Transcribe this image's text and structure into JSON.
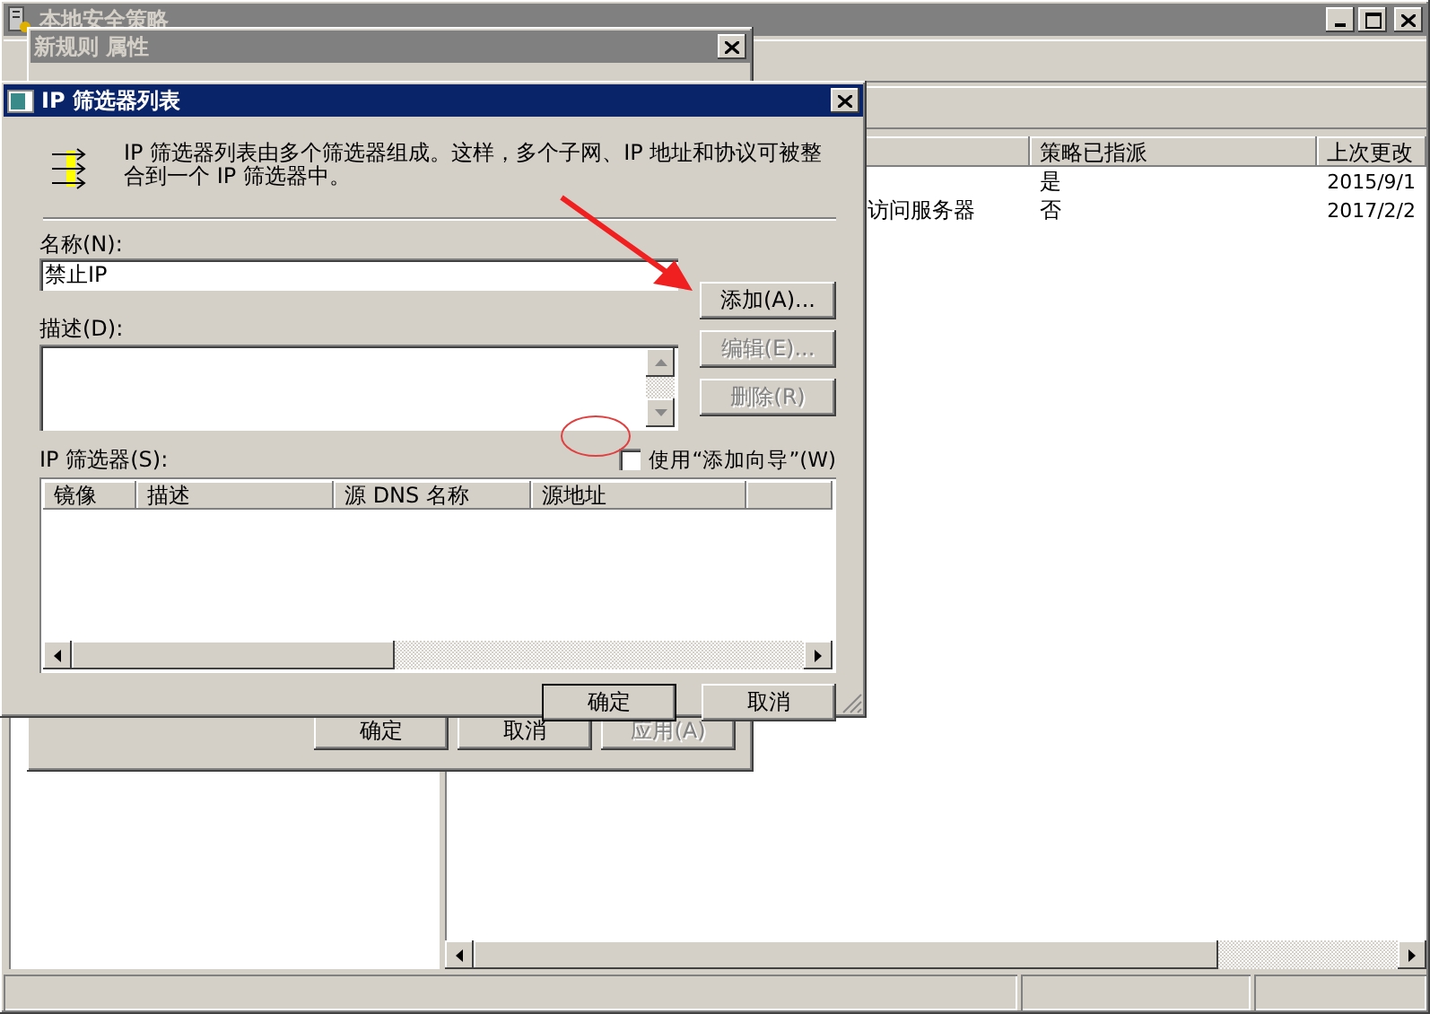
{
  "main_window": {
    "title": "本地安全策略",
    "list": {
      "columns": [
        {
          "label": "策略已指派"
        },
        {
          "label": "上次更改"
        }
      ],
      "rows": [
        {
          "assigned": "是",
          "changed": "2015/9/1"
        },
        {
          "name": "访问服务器",
          "assigned": "否",
          "changed": "2017/2/2"
        }
      ]
    }
  },
  "properties_dialog": {
    "title": "新规则 属性",
    "buttons": [
      {
        "label": "确定",
        "disabled": false
      },
      {
        "label": "取消",
        "disabled": false
      },
      {
        "label": "应用(A)",
        "disabled": true
      }
    ]
  },
  "filter_list_dialog": {
    "title": "IP 筛选器列表",
    "description": "IP 筛选器列表由多个筛选器组成。这样，多个子网、IP 地址和协议可被整合到一个 IP 筛选器中。",
    "name_label": "名称(N):",
    "name_value": "禁止IP",
    "description_label": "描述(D):",
    "side_buttons": [
      {
        "label": "添加(A)...",
        "disabled": false
      },
      {
        "label": "编辑(E)...",
        "disabled": true
      },
      {
        "label": "删除(R)",
        "disabled": true
      }
    ],
    "filters_label": "IP 筛选器(S):",
    "wizard_checkbox": {
      "label": "使用“添加向导”(W)",
      "checked": false
    },
    "columns": [
      {
        "label": "镜像"
      },
      {
        "label": "描述"
      },
      {
        "label": "源 DNS 名称"
      },
      {
        "label": "源地址"
      }
    ],
    "footer_buttons": [
      {
        "label": "确定",
        "default": true
      },
      {
        "label": "取消",
        "default": false
      }
    ]
  }
}
